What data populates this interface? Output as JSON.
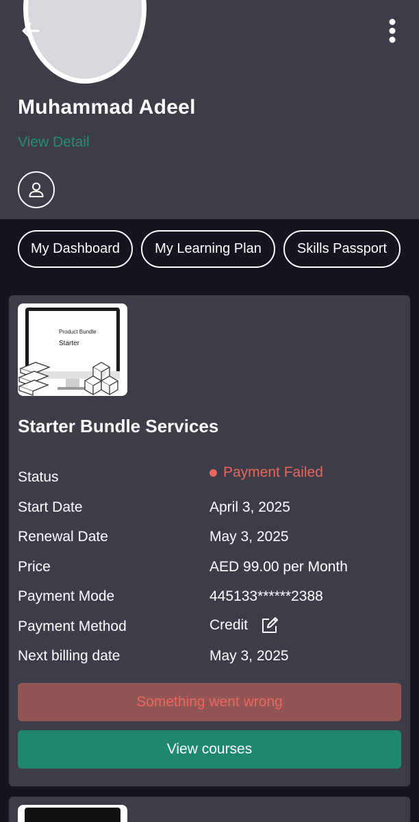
{
  "profile": {
    "name": "Muhammad Adeel",
    "view_detail": "View Detail"
  },
  "nav_chips": [
    {
      "label": "My Dashboard"
    },
    {
      "label": "My Learning Plan"
    },
    {
      "label": "Skills Passport"
    }
  ],
  "bundle": {
    "thumbnail": {
      "line1": "Product Bundle",
      "line2": "Starter"
    },
    "title": "Starter Bundle Services",
    "details": [
      {
        "label": "Status",
        "value": "Payment Failed"
      },
      {
        "label": "Start Date",
        "value": "April 3, 2025"
      },
      {
        "label": "Renewal Date",
        "value": "May 3, 2025"
      },
      {
        "label": "Price",
        "value": "AED 99.00 per Month"
      },
      {
        "label": "Payment Mode",
        "value": "445133******2388"
      },
      {
        "label": "Payment Method",
        "value": "Credit"
      },
      {
        "label": "Next billing date",
        "value": "May 3, 2025"
      }
    ],
    "error_button": "Something went wrong",
    "courses_button": "View courses"
  },
  "icons": {
    "back": "arrow-left-icon",
    "menu": "more-vertical-icon",
    "user": "user-icon",
    "edit": "edit-icon"
  },
  "colors": {
    "header_bg": "#3c3d49",
    "page_bg": "#15151f",
    "accent_teal": "#1f8770",
    "link_teal": "#2a8a72",
    "error_red": "#e8665d",
    "error_btn_bg": "#935454"
  }
}
